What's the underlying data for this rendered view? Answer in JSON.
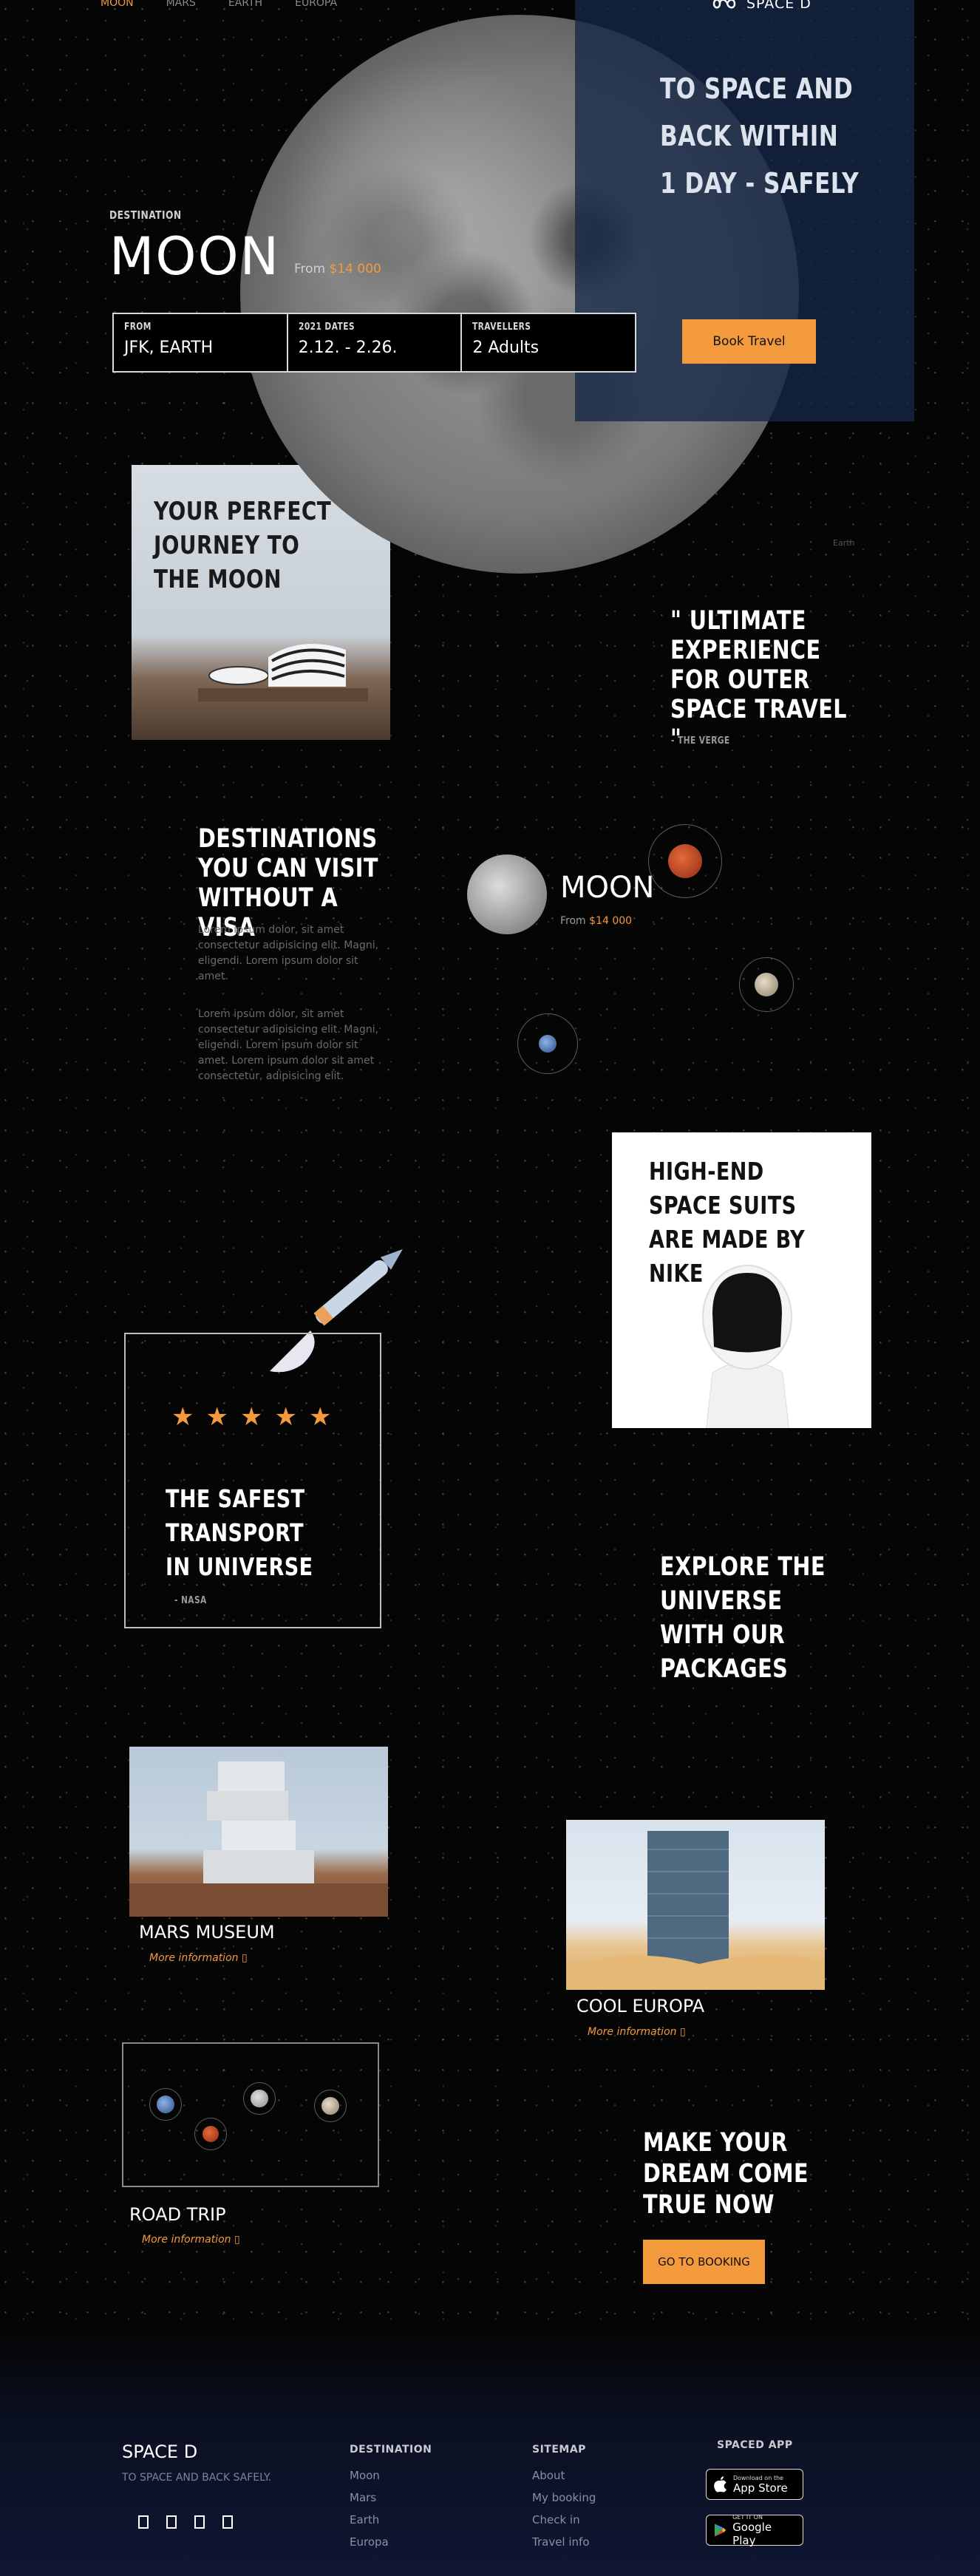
{
  "nav": {
    "items": [
      "MOON",
      "MARS",
      "EARTH",
      "EUROPA"
    ]
  },
  "brand": {
    "name": "SPACE D"
  },
  "hero": {
    "claim_lines": [
      "TO SPACE AND",
      "BACK WITHIN",
      "1 DAY - SAFELY"
    ],
    "destination_label": "DESTINATION",
    "destination": "MOON",
    "from_label": "From",
    "price": "$14 000",
    "booking": [
      {
        "label": "FROM",
        "value": "JFK, EARTH"
      },
      {
        "label": "2021 DATES",
        "value": "2.12. - 2.26."
      },
      {
        "label": "TRAVELLERS",
        "value": "2 Adults"
      }
    ],
    "book_button": "Book Travel"
  },
  "journey": {
    "title": "YOUR PERFECT JOURNEY TO THE MOON"
  },
  "broken_image_alt": "Earth",
  "quote": {
    "text": "\" ULTIMATE EXPERIENCE FOR OUTER SPACE TRAVEL \"",
    "source": "- THE VERGE"
  },
  "destinations": {
    "title": "DESTINATIONS YOU CAN VISIT WITHOUT A VISA",
    "p1": "Lorem ipsum dolor, sit amet consectetur adipisicing elit. Magni, eligendi. Lorem ipsum dolor sit amet.",
    "p2": "Lorem ipsum dolor, sit amet consectetur adipisicing elit. Magni, eligendi. Lorem ipsum dolor sit amet. Lorem ipsum dolor sit amet consectetur, adipisicing elit.",
    "featured": {
      "name": "MOON",
      "from_label": "From",
      "price": "$14 000"
    }
  },
  "nike": {
    "title": "HIGH-END SPACE SUITS ARE MADE BY NIKE"
  },
  "safest": {
    "stars": [
      "★",
      "★",
      "★",
      "★",
      "★"
    ],
    "title": "THE SAFEST TRANSPORT IN UNIVERSE",
    "source": "- NASA"
  },
  "explore": {
    "title": "EXPLORE THE UNIVERSE WITH OUR PACKAGES"
  },
  "packages": [
    {
      "name": "MARS MUSEUM",
      "more": "More information  ▯"
    },
    {
      "name": "COOL EUROPA",
      "more": "More information  ▯"
    },
    {
      "name": "ROAD TRIP",
      "more": "More information  ▯"
    }
  ],
  "cta": {
    "title": "MAKE YOUR DREAM COME TRUE NOW",
    "button": "GO TO BOOKING"
  },
  "footer": {
    "brand": "SPACE D",
    "tagline": "TO SPACE AND BACK SAFELY.",
    "destination": {
      "title": "DESTINATION",
      "links": [
        "Moon",
        "Mars",
        "Earth",
        "Europa"
      ]
    },
    "sitemap": {
      "title": "SITEMAP",
      "links": [
        "About",
        "My booking",
        "Check in",
        "Travel info"
      ]
    },
    "app": {
      "title": "SPACED APP",
      "appstore_small": "Download on the",
      "appstore_big": "App Store",
      "gplay_small": "GET IT ON",
      "gplay_big": "Google Play"
    }
  },
  "colors": {
    "accent": "#f39a3d",
    "panel": "#142846",
    "footer": "#101632"
  }
}
